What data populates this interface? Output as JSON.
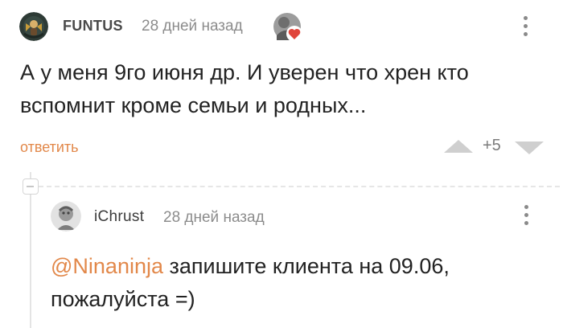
{
  "comment": {
    "author": "FUNTUS",
    "time": "28 дней назад",
    "text": "А у меня 9го июня др. И уверен что хрен кто вспомнит кроме семьи и родных...",
    "reply_label": "ответить",
    "rating": "+5"
  },
  "reply": {
    "author": "iChrust",
    "time": "28 дней назад",
    "mention": "@Ninaninja",
    "text": " запишите клиента на 09.06, пожалуйста =)"
  },
  "colors": {
    "accent": "#e2884a",
    "muted": "#8c8c8c",
    "text": "#222222"
  }
}
